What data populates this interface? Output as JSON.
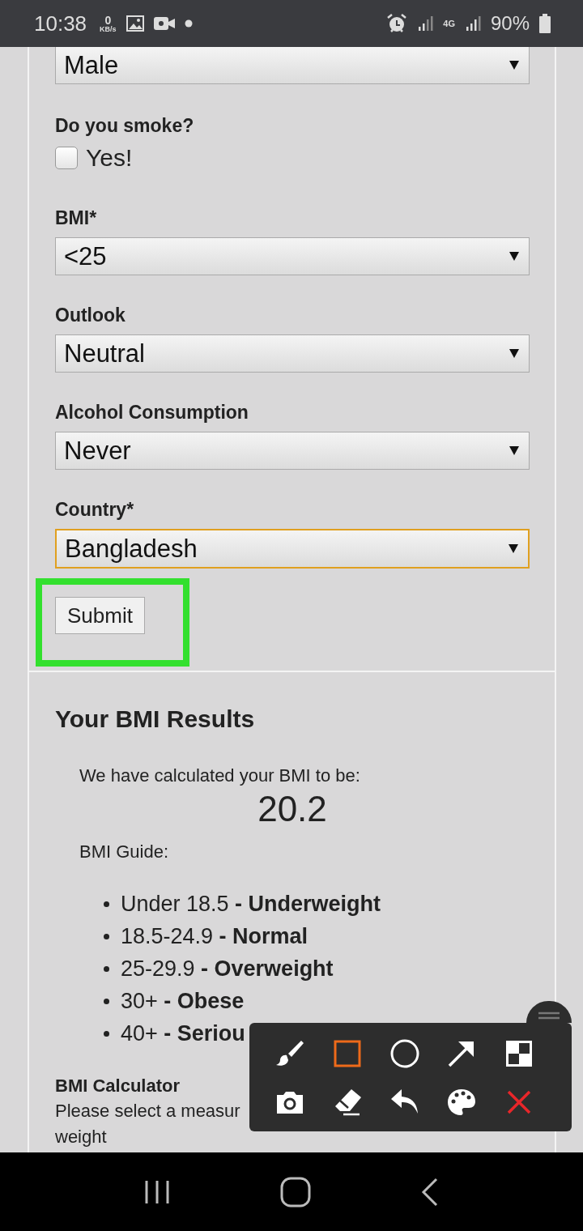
{
  "status_bar": {
    "time": "10:38",
    "net_speed": "0",
    "net_unit": "KB/s",
    "network": "4G",
    "battery": "90%"
  },
  "form": {
    "gender_select": {
      "value": "Male"
    },
    "smoke": {
      "label": "Do you smoke?",
      "option": "Yes!",
      "checked": false
    },
    "selects": [
      {
        "label": "BMI*",
        "value": "<25",
        "focused": false
      },
      {
        "label": "Outlook",
        "value": "Neutral",
        "focused": false
      },
      {
        "label": "Alcohol Consumption",
        "value": "Never",
        "focused": false
      },
      {
        "label": "Country*",
        "value": "Bangladesh",
        "focused": true
      }
    ],
    "submit": {
      "label": "Submit",
      "highlighted": true
    }
  },
  "results": {
    "title": "Your BMI Results",
    "intro": "We have calculated your BMI to be:",
    "value": "20.2",
    "guide_label": "BMI Guide:",
    "guide": [
      "Under 18.5 **- Underweight**",
      "18.5-24.9 **- Normal**",
      "25-29.9 **- Overweight**",
      "30+ **- Obese**",
      "40+ **- Seriou**"
    ]
  },
  "calculator": {
    "title": "BMI Calculator",
    "lines": [
      "Please select a measur",
      "weight"
    ]
  },
  "toolbar": {
    "tools": [
      {
        "kind": "brush",
        "selected": false
      },
      {
        "kind": "rectangle",
        "selected": true
      },
      {
        "kind": "circle",
        "selected": false
      },
      {
        "kind": "arrow",
        "selected": false
      },
      {
        "kind": "mosaic",
        "selected": false
      },
      {
        "kind": "camera",
        "selected": false
      },
      {
        "kind": "eraser",
        "selected": false
      },
      {
        "kind": "undo",
        "selected": false
      },
      {
        "kind": "palette",
        "selected": false
      },
      {
        "kind": "close",
        "selected": false
      }
    ]
  }
}
